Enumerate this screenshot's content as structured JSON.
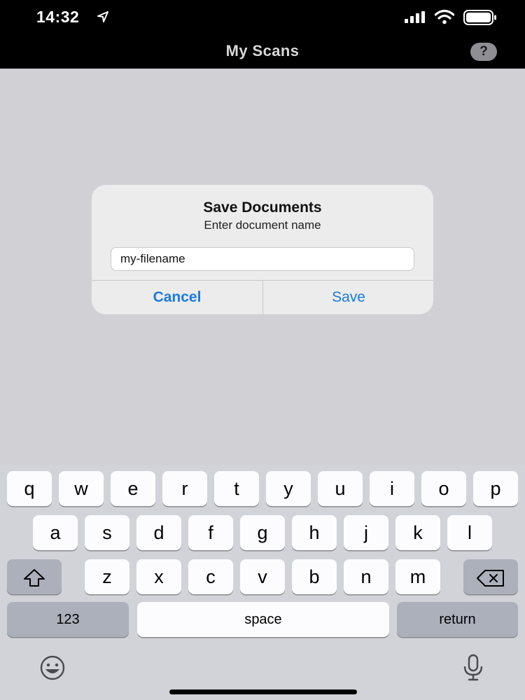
{
  "status_bar": {
    "time": "14:32"
  },
  "nav": {
    "title": "My Scans",
    "help_label": "?"
  },
  "alert": {
    "title": "Save Documents",
    "message": "Enter document name",
    "input_value": "my-filename",
    "cancel_label": "Cancel",
    "save_label": "Save"
  },
  "keyboard": {
    "row1": [
      "q",
      "w",
      "e",
      "r",
      "t",
      "y",
      "u",
      "i",
      "o",
      "p"
    ],
    "row2": [
      "a",
      "s",
      "d",
      "f",
      "g",
      "h",
      "j",
      "k",
      "l"
    ],
    "row3": [
      "z",
      "x",
      "c",
      "v",
      "b",
      "n",
      "m"
    ],
    "numbers_label": "123",
    "space_label": "space",
    "return_label": "return"
  },
  "colors": {
    "accent": "#1a7ae6",
    "key": "#fcfcfe",
    "func_key": "#abb0bb",
    "keyboard_bg": "#d1d3d9"
  }
}
